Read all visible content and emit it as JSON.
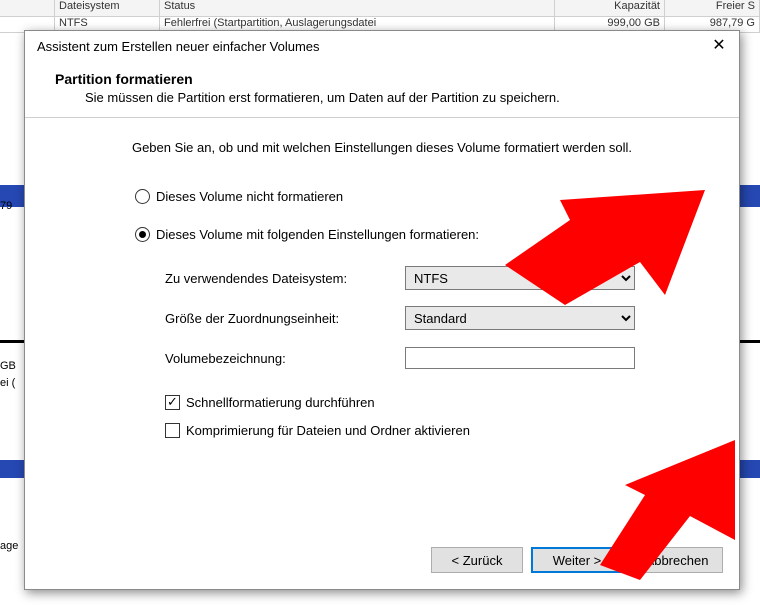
{
  "bg": {
    "headers": {
      "c1": "Dateisystem",
      "c2": "Status",
      "c3": "Kapazität",
      "c4": "Freier S"
    },
    "row": {
      "fs": "NTFS",
      "status": "Fehlerfrei (Startpartition, Auslagerungsdatei",
      "cap": "999,00 GB",
      "free": "987,79 G"
    },
    "side": {
      "l1": "79",
      "l2": "GB",
      "l3": "ei (",
      "l4": "age"
    }
  },
  "wizard": {
    "title": "Assistent zum Erstellen neuer einfacher Volumes",
    "header_title": "Partition formatieren",
    "header_sub": "Sie müssen die Partition erst formatieren, um Daten auf der Partition zu speichern.",
    "intro": "Geben Sie an, ob und mit welchen Einstellungen dieses Volume formatiert werden soll.",
    "radios": {
      "no_format": "Dieses Volume nicht formatieren",
      "do_format": "Dieses Volume mit folgenden Einstellungen formatieren:"
    },
    "fields": {
      "fs_label": "Zu verwendendes Dateisystem:",
      "fs_value": "NTFS",
      "alloc_label": "Größe der Zuordnungseinheit:",
      "alloc_value": "Standard",
      "vol_label": "Volumebezeichnung:",
      "vol_value": "",
      "quick_label": "Schnellformatierung durchführen",
      "compress_label": "Komprimierung für Dateien und Ordner aktivieren"
    },
    "buttons": {
      "back": "< Zurück",
      "next": "Weiter >",
      "cancel": "Abbrechen"
    }
  }
}
